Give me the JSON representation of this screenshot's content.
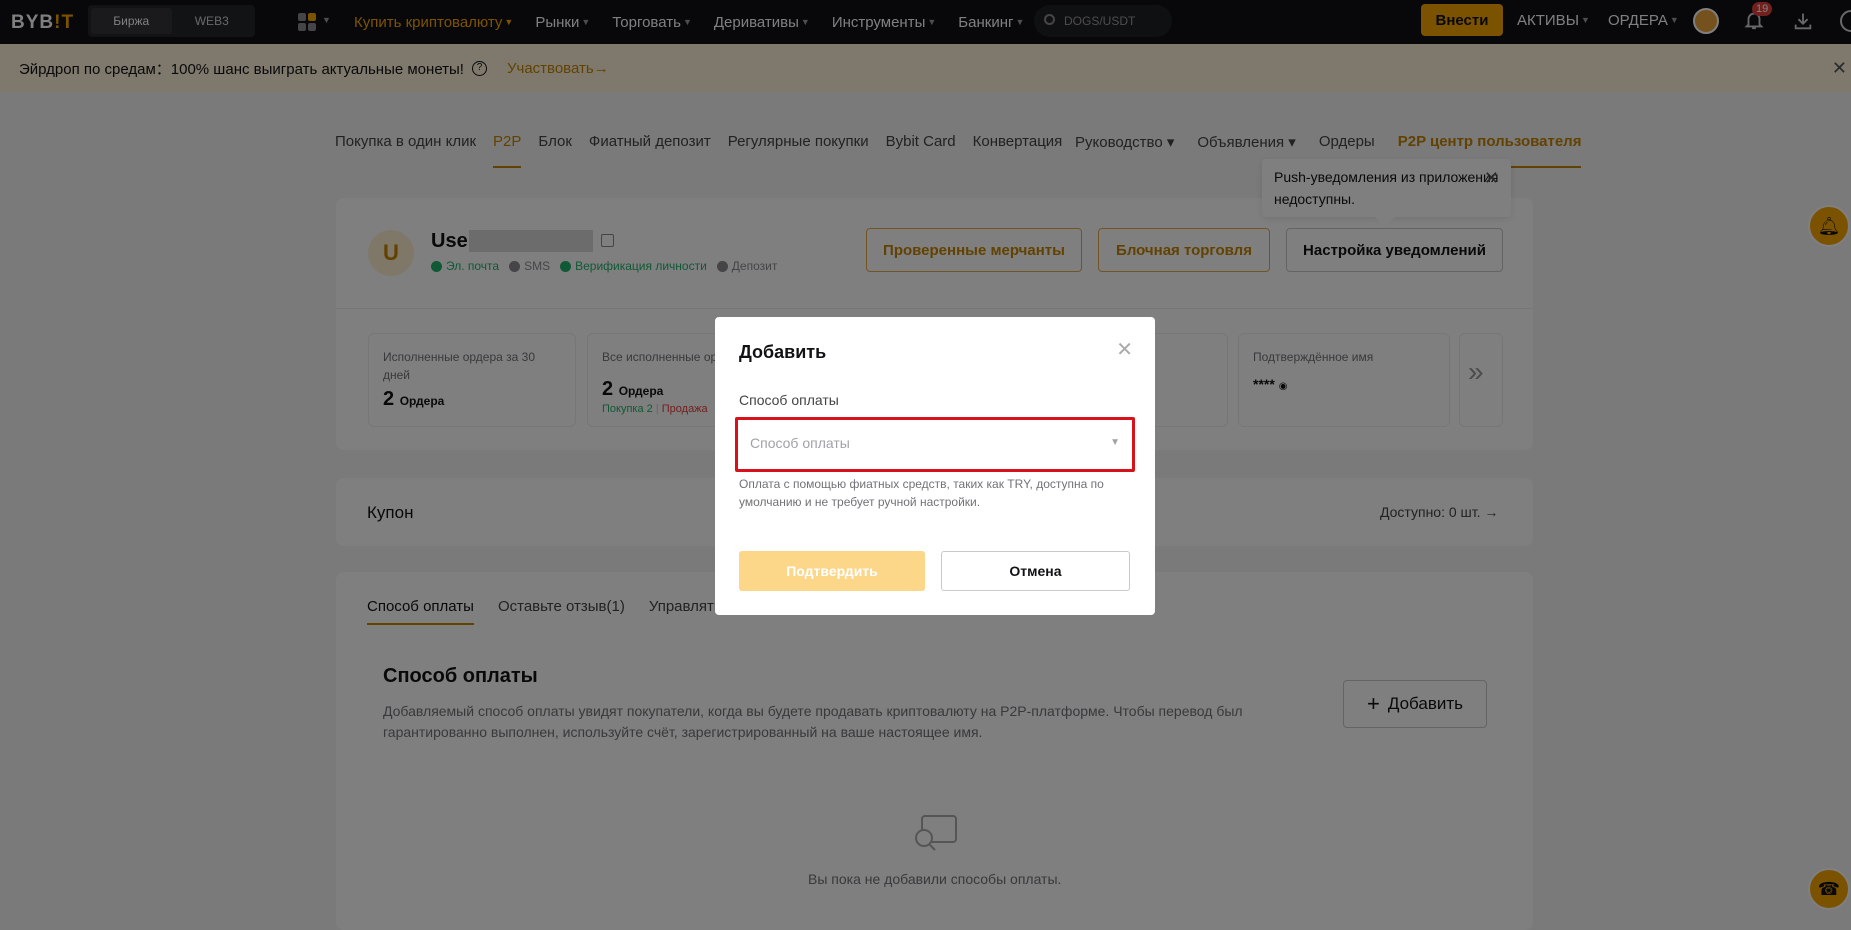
{
  "topnav": {
    "logo_a": "BYB",
    "logo_b": "!T",
    "seg": [
      "Биржа",
      "WEB3"
    ],
    "links": [
      {
        "label": "Купить криптовалюту",
        "active": true
      },
      {
        "label": "Рынки"
      },
      {
        "label": "Торговать"
      },
      {
        "label": "Деривативы"
      },
      {
        "label": "Инструменты"
      },
      {
        "label": "Банкинг"
      }
    ],
    "search_text": "DOGS/USDT",
    "deposit_label": "Внести",
    "assets_label": "АКТИВЫ",
    "orders_label": "ОРДЕРА",
    "notif_count": "19"
  },
  "banner": {
    "text": "Эйрдроп по средам：100% шанс выиграть актуальные монеты!",
    "join_label": "Участвовать",
    "arrow": "→"
  },
  "subnav": {
    "left": [
      "Покупка в один клик",
      "P2P",
      "Блок",
      "Фиатный депозит",
      "Регулярные покупки",
      "Bybit Card",
      "Конвертация"
    ],
    "right": [
      "Руководство",
      "Объявления",
      "Ордеры",
      "P2P центр пользователя"
    ]
  },
  "profile": {
    "initial": "U",
    "name": "User",
    "verif": [
      "Эл. почта",
      "SMS",
      "Верификация личности",
      "Депозит"
    ],
    "btn_merchants": "Проверенные мерчанты",
    "btn_block": "Блочная торговля",
    "btn_notif": "Настройка уведомлений"
  },
  "tooltip": {
    "text": "Push-уведомления из приложения недоступны."
  },
  "stats": [
    {
      "label": "Исполненные ордера за 30 дней",
      "value": "2",
      "unit": "Ордера"
    },
    {
      "label": "Все исполненные ордера",
      "value": "2",
      "unit": "Ордера",
      "buy": "Покупка 2",
      "sell": "Продажа"
    },
    {
      "label": "Подтверждённое имя",
      "value": "****"
    }
  ],
  "coupon": {
    "title": "Купон",
    "available": "Доступно: 0 шт."
  },
  "tabs": [
    "Способ оплаты",
    "Оставьте отзыв(1)",
    "Управлять"
  ],
  "payment": {
    "title": "Способ оплаты",
    "desc": "Добавляемый способ оплаты увидят покупатели, когда вы будете продавать криптовалюту на P2P-платформе. Чтобы перевод был гарантированно выполнен, используйте счёт, зарегистрированный на ваше настоящее имя.",
    "add_label": "Добавить",
    "empty": "Вы пока не добавили способы оплаты."
  },
  "modal": {
    "title": "Добавить",
    "field_label": "Способ оплаты",
    "placeholder": "Способ оплаты",
    "hint": "Оплата с помощью фиатных средств, таких как TRY, доступна по умолчанию и не требует ручной настройки.",
    "confirm": "Подтвердить",
    "cancel": "Отмена"
  },
  "colors": {
    "accent": "#f7a600",
    "highlight_border": "#d8111a"
  }
}
